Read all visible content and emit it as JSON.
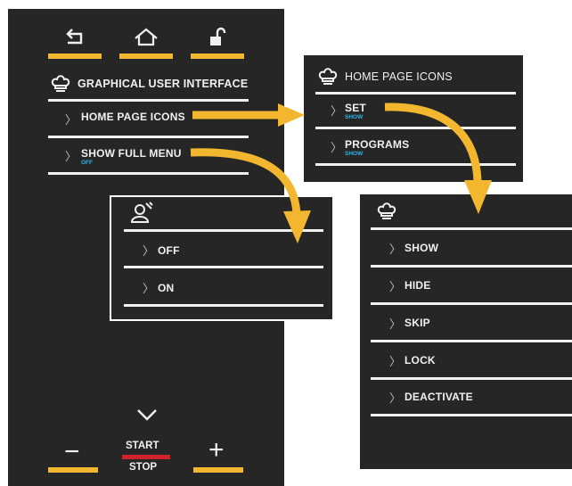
{
  "colors": {
    "accent": "#f2b72e",
    "panel": "#262626",
    "separator": "#f1f1f1",
    "sublabel": "#2fb3e8",
    "stop_bar": "#d0212c"
  },
  "main": {
    "top_buttons": [
      {
        "icon": "back-arrow-icon"
      },
      {
        "icon": "home-icon"
      },
      {
        "icon": "unlock-icon"
      }
    ],
    "title": "GRAPHICAL USER INTERFACE",
    "items": [
      {
        "label": "HOME PAGE ICONS",
        "sub": ""
      },
      {
        "label": "SHOW FULL MENU",
        "sub": "OFF"
      }
    ],
    "bottom": {
      "minus": "−",
      "plus": "+",
      "start": "START",
      "stop": "STOP"
    }
  },
  "home_page_icons": {
    "title": "HOME PAGE ICONS",
    "items": [
      {
        "label": "SET",
        "sub": "SHOW"
      },
      {
        "label": "PROGRAMS",
        "sub": "SHOW"
      }
    ]
  },
  "show_full_menu": {
    "items": [
      {
        "label": "OFF"
      },
      {
        "label": "ON"
      }
    ]
  },
  "set_menu": {
    "items": [
      {
        "label": "SHOW"
      },
      {
        "label": "HIDE"
      },
      {
        "label": "SKIP"
      },
      {
        "label": "LOCK"
      },
      {
        "label": "DEACTIVATE"
      }
    ]
  }
}
